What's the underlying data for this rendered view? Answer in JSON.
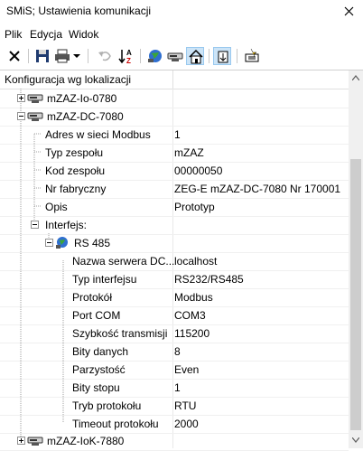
{
  "window": {
    "title": "SMiS; Ustawienia komunikacji",
    "close_icon": "close-icon"
  },
  "menu": [
    "Plik",
    "Edycja",
    "Widok"
  ],
  "toolbar": {
    "buttons": [
      {
        "name": "delete-button",
        "icon": "delete-icon"
      },
      {
        "name": "save-button",
        "icon": "save-icon"
      },
      {
        "name": "print-button",
        "icon": "printer-icon"
      },
      {
        "name": "print-dropdown-button",
        "icon": "chevron-down-icon"
      },
      {
        "name": "undo-button",
        "icon": "undo-icon"
      },
      {
        "name": "sort-button",
        "icon": "sort-az-icon"
      },
      {
        "name": "network-button",
        "icon": "network-globe-icon"
      },
      {
        "name": "device-button",
        "icon": "device-icon"
      },
      {
        "name": "home-button",
        "icon": "home-icon"
      },
      {
        "name": "expand-button",
        "icon": "expand-icon"
      },
      {
        "name": "add-device-button",
        "icon": "add-device-icon"
      }
    ]
  },
  "tree": {
    "header": "Konfiguracja wg lokalizacji",
    "nodes": [
      {
        "label": "mZAZ-Io-0780",
        "value": ""
      },
      {
        "label": "mZAZ-DC-7080",
        "value": ""
      },
      {
        "label": "Adres w sieci Modbus",
        "value": "1"
      },
      {
        "label": "Typ zespołu",
        "value": "mZAZ"
      },
      {
        "label": "Kod zespołu",
        "value": "00000050"
      },
      {
        "label": "Nr fabryczny",
        "value": "ZEG-E  mZAZ-DC-7080 Nr 170001"
      },
      {
        "label": "Opis",
        "value": "Prototyp"
      },
      {
        "label": "Interfejs:",
        "value": ""
      },
      {
        "label": "RS 485",
        "value": ""
      },
      {
        "label": "Nazwa serwera DC...",
        "value": "localhost"
      },
      {
        "label": "Typ interfejsu",
        "value": "RS232/RS485"
      },
      {
        "label": "Protokół",
        "value": "Modbus"
      },
      {
        "label": "Port COM",
        "value": "COM3"
      },
      {
        "label": "Szybkość transmisji",
        "value": "115200"
      },
      {
        "label": "Bity danych",
        "value": "8"
      },
      {
        "label": "Parzystość",
        "value": "Even"
      },
      {
        "label": "Bity stopu",
        "value": "1"
      },
      {
        "label": "Tryb protokołu",
        "value": "RTU"
      },
      {
        "label": "Timeout protokołu",
        "value": "2000"
      },
      {
        "label": "mZAZ-IoK-7880",
        "value": ""
      }
    ]
  },
  "colors": {
    "selected_tool_bg": "#cce4f7",
    "scrollbar_thumb": "#cdcdcd",
    "tree_line": "#a0a0a0"
  }
}
